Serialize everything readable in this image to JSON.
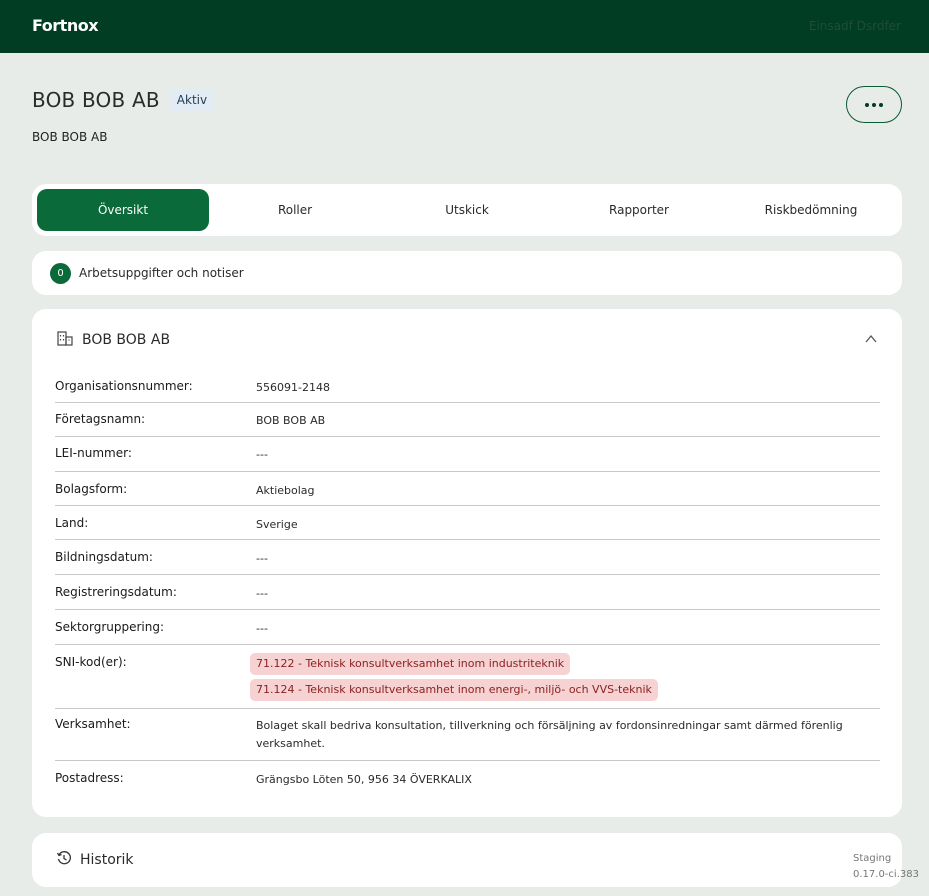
{
  "brand": "Fortnox",
  "user": "Einsadf Dsrdfer",
  "company": {
    "title": "BOB BOB AB",
    "status": "Aktiv",
    "subtitle": "BOB BOB AB"
  },
  "tabs": [
    "Översikt",
    "Roller",
    "Utskick",
    "Rapporter",
    "Riskbedömning"
  ],
  "tasks": {
    "count": "0",
    "label": "Arbetsuppgifter och notiser"
  },
  "card": {
    "title": "BOB BOB AB",
    "rows": [
      {
        "label": "Organisationsnummer:",
        "value": "556091-2148"
      },
      {
        "label": "Företagsnamn:",
        "value": "BOB BOB AB"
      },
      {
        "label": "LEI-nummer:",
        "value": "---"
      },
      {
        "label": "Bolagsform:",
        "value": "Aktiebolag"
      },
      {
        "label": "Land:",
        "value": "Sverige"
      },
      {
        "label": "Bildningsdatum:",
        "value": "---"
      },
      {
        "label": "Registreringsdatum:",
        "value": "---"
      },
      {
        "label": "Sektorgruppering:",
        "value": "---"
      },
      {
        "label": "SNI-kod(er):",
        "chips": [
          "71.122 - Teknisk konsultverksamhet inom industriteknik",
          "71.124 - Teknisk konsultverksamhet inom energi-, miljö- och VVS-teknik"
        ]
      },
      {
        "label": "Verksamhet:",
        "value": "Bolaget skall bedriva konsultation, tillverkning och försäljning av fordonsinredningar samt därmed förenlig verksamhet."
      },
      {
        "label": "Postadress:",
        "value": "Grängsbo Löten 50, 956 34 ÖVERKALIX"
      }
    ]
  },
  "history": {
    "title": "Historik"
  },
  "environment": {
    "name": "Staging",
    "version": "0.17.0-ci.383"
  },
  "colors": {
    "topbar": "#003d23",
    "accent": "#0a6a3a",
    "chip_bg": "#f6d2d2",
    "chip_text": "#8a1f1f"
  }
}
